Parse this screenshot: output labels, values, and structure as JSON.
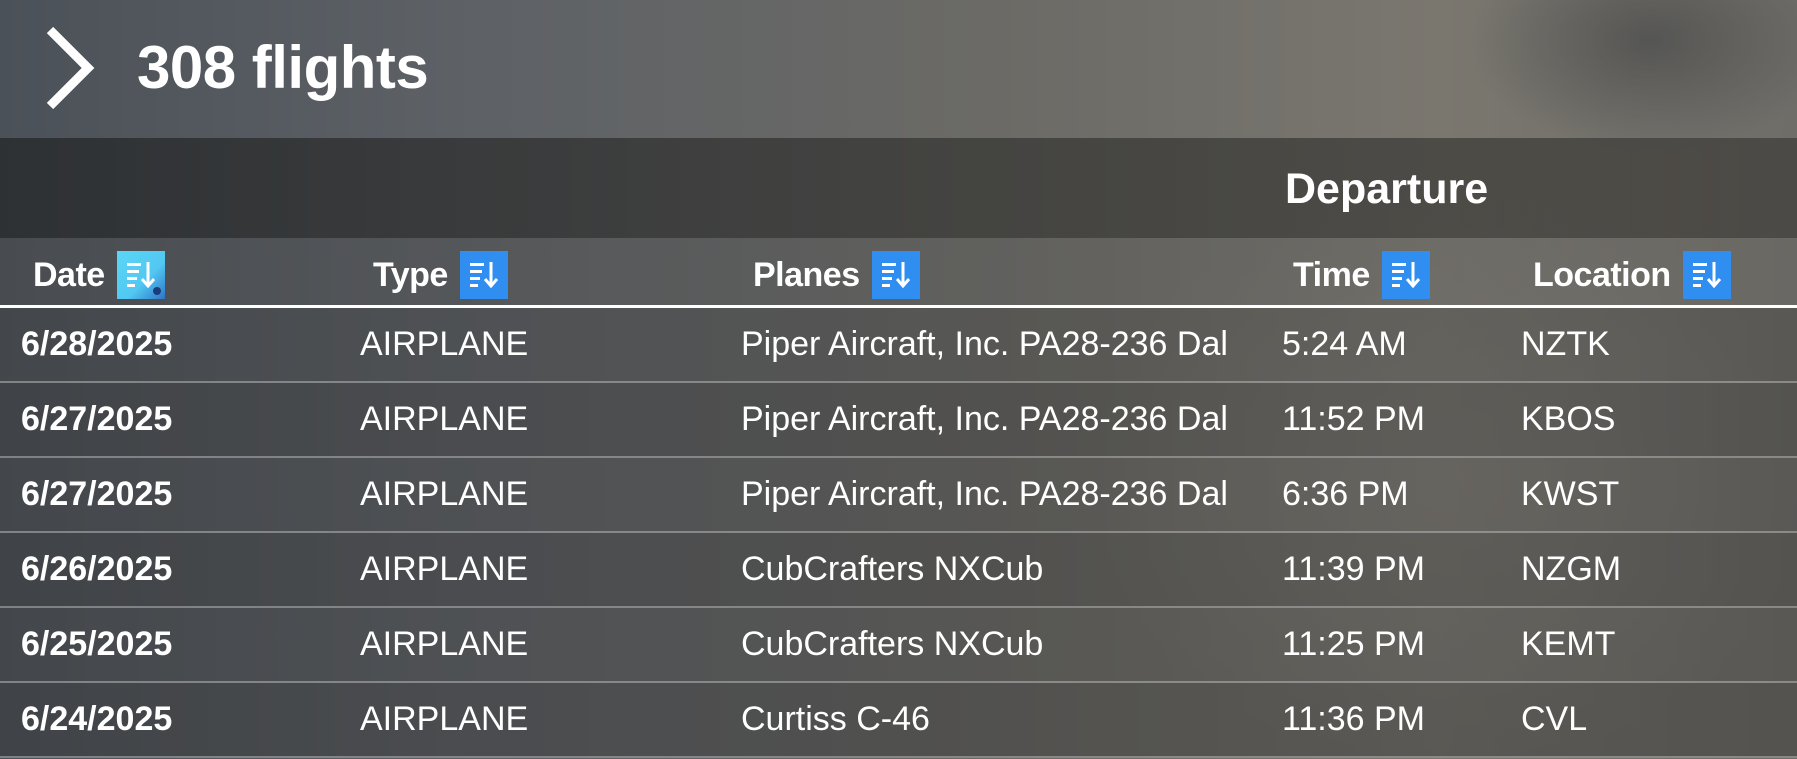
{
  "header": {
    "title": "308 flights"
  },
  "group": {
    "departure_label": "Departure"
  },
  "columns": [
    {
      "label": "Date",
      "icon": "sort-icon",
      "active": true
    },
    {
      "label": "Type",
      "icon": "sort-icon",
      "active": false
    },
    {
      "label": "Planes",
      "icon": "sort-icon",
      "active": false
    },
    {
      "label": "Time",
      "icon": "sort-icon",
      "active": false
    },
    {
      "label": "Location",
      "icon": "sort-icon",
      "active": false
    }
  ],
  "rows": [
    {
      "date": "6/28/2025",
      "type": "AIRPLANE",
      "plane": "Piper Aircraft, Inc. PA28-236 Dal",
      "time": "5:24 AM",
      "location": "NZTK"
    },
    {
      "date": "6/27/2025",
      "type": "AIRPLANE",
      "plane": "Piper Aircraft, Inc. PA28-236 Dal",
      "time": "11:52 PM",
      "location": "KBOS"
    },
    {
      "date": "6/27/2025",
      "type": "AIRPLANE",
      "plane": "Piper Aircraft, Inc. PA28-236 Dal",
      "time": "6:36 PM",
      "location": "KWST"
    },
    {
      "date": "6/26/2025",
      "type": "AIRPLANE",
      "plane": "CubCrafters NXCub",
      "time": "11:39 PM",
      "location": "NZGM"
    },
    {
      "date": "6/25/2025",
      "type": "AIRPLANE",
      "plane": "CubCrafters NXCub",
      "time": "11:25 PM",
      "location": "KEMT"
    },
    {
      "date": "6/24/2025",
      "type": "AIRPLANE",
      "plane": "Curtiss C-46",
      "time": "11:36 PM",
      "location": "CVL"
    }
  ],
  "colors": {
    "sort_button": "#2f8ef0",
    "sort_button_active": "#52c8f2",
    "text": "#ffffff"
  }
}
